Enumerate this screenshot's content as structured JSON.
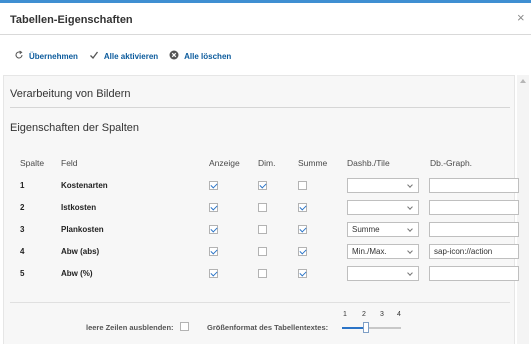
{
  "dialog": {
    "title": "Tabellen-Eigenschaften",
    "close_glyph": "×"
  },
  "toolbar": {
    "apply_label": "Übernehmen",
    "activate_all_label": "Alle aktivieren",
    "delete_all_label": "Alle löschen"
  },
  "sections": {
    "image_processing": "Verarbeitung von Bildern",
    "column_properties": "Eigenschaften der Spalten"
  },
  "table": {
    "headers": {
      "col": "Spalte",
      "field": "Feld",
      "display": "Anzeige",
      "dim": "Dim.",
      "sum": "Summe",
      "dashb": "Dashb./Tile",
      "dbgraph": "Db.-Graph."
    },
    "rows": [
      {
        "nr": "1",
        "field": "Kostenarten",
        "display": true,
        "dim": true,
        "sum": false,
        "dashb": "",
        "dbgraph": ""
      },
      {
        "nr": "2",
        "field": "Istkosten",
        "display": true,
        "dim": false,
        "sum": true,
        "dashb": "",
        "dbgraph": ""
      },
      {
        "nr": "3",
        "field": "Plankosten",
        "display": true,
        "dim": false,
        "sum": true,
        "dashb": "Summe",
        "dbgraph": ""
      },
      {
        "nr": "4",
        "field": "Abw (abs)",
        "display": true,
        "dim": false,
        "sum": true,
        "dashb": "Min./Max.",
        "dbgraph": "sap-icon://action"
      },
      {
        "nr": "5",
        "field": "Abw (%)",
        "display": true,
        "dim": false,
        "sum": true,
        "dashb": "",
        "dbgraph": ""
      }
    ]
  },
  "footer": {
    "hide_empty_rows_label": "leere Zeilen ausblenden:",
    "hide_empty_rows_checked": false,
    "font_size_label": "Größenformat des Tabellentextes:",
    "font_size_ticks": [
      "1",
      "2",
      "3",
      "4"
    ],
    "font_size_value": 2
  },
  "colors": {
    "accent": "#3f8fd2",
    "link": "#0a5a9c",
    "check": "#2b74c7",
    "panel_bg": "#f7f7f7"
  },
  "icons": {
    "apply": "refresh-icon",
    "activate_all": "checkmark-icon",
    "delete_all": "clear-circle-icon",
    "close": "close-icon",
    "dropdown": "chevron-down-icon"
  }
}
